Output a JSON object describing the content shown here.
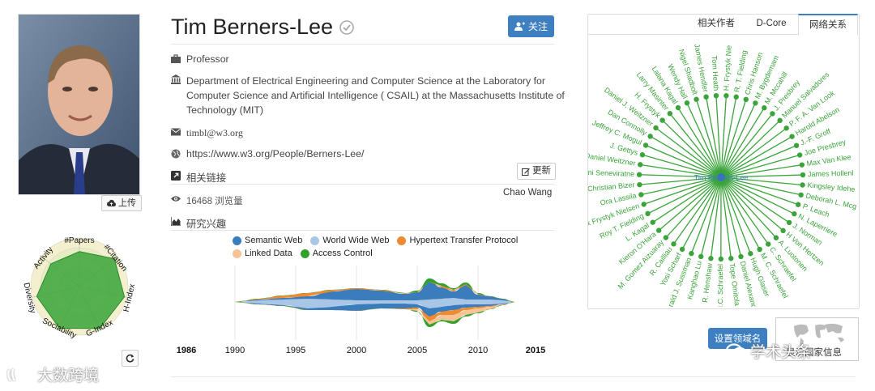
{
  "profile": {
    "name": "Tim Berners-Lee",
    "follow_label": "关注",
    "title": "Professor",
    "affiliation": "Department of Electrical Engineering and Computer Science at the Laboratory for Computer Science and Artificial Intelligence ( CSAIL) at the Massachusetts Institute of Technology (MIT)",
    "email": "timbl@w3.org",
    "homepage": "https://www.w3.org/People/Berners-Lee/",
    "related_links_label": "相关链接",
    "update_label": "更新",
    "editor": "Chao Wang",
    "views": "16468 浏览量",
    "interests_label": "研究兴趣",
    "upload_label": "上传"
  },
  "radar": {
    "axes": [
      "#Papers",
      "#Citation",
      "H-Index",
      "G-Index",
      "Sociability",
      "Diversity",
      "Activity"
    ],
    "values": [
      0.72,
      0.92,
      0.95,
      0.96,
      0.95,
      0.9,
      0.75
    ],
    "fill_color": "#3aa43a",
    "ring_colors": [
      "#f4f0cf",
      "#e6ecc4"
    ]
  },
  "interest_chart": {
    "legend": [
      {
        "name": "Semantic Web",
        "color": "#3b7cbd"
      },
      {
        "name": "World Wide Web",
        "color": "#a9c6e6"
      },
      {
        "name": "Hypertext Transfer Protocol",
        "color": "#ee8a2f"
      },
      {
        "name": "Linked Data",
        "color": "#f6c394"
      },
      {
        "name": "Access Control",
        "color": "#33a02c"
      }
    ],
    "start_year": "1986",
    "end_year": "2015",
    "ticks": [
      "1990",
      "1995",
      "2000",
      "2005",
      "2010"
    ]
  },
  "tabs": [
    {
      "label": "相关作者",
      "active": false
    },
    {
      "label": "D-Core",
      "active": false
    },
    {
      "label": "网络关系",
      "active": true
    }
  ],
  "network": {
    "center": "Tim Berners-Lee",
    "color": "#3aa43a",
    "nodes": [
      "Tom Heath",
      "H. Frystyk Nie",
      "R. T. Fielding",
      "Chris Hanson",
      "M. Bygdemam",
      "M. Mccahill",
      "J. Presbrey",
      "Manuel Salvadores",
      "P. F. A. Van Look",
      "Harold Abelson",
      "J.-F. Groff",
      "Joe Presbrey",
      "Max Van Klee",
      "James Hollenl",
      "Kingsley Idehe",
      "Deborah L. Mcg",
      "P. Leach",
      "N. Laperriere",
      "J. Norman",
      "H Von Hertzen",
      "A. Luotonen",
      "C. Schraefel",
      "M. C. Schraefel",
      "Hugh Glaser",
      "Daniel Alexander",
      "Tope Omitola",
      "M.C. Schraefel",
      "R. Henshaw",
      "Kanghao Lu",
      "Gerald J. Sussman",
      "Yosi Scharf",
      "R. Cailliau",
      "M. Gomez Aizuaray",
      "Kieron O'Hara",
      "L. Kagal",
      "Roy T. Fielding",
      "x Frystyk Nielsen",
      "Ora Lassila",
      "Christian Bizer",
      "ani Seneviratne",
      "Daniel Weitzner",
      "J. Gettys",
      "Jeffrey C. Mogul",
      "Dan Connolly",
      "Daniel J. Weitzner",
      "H. Frystyk",
      "Larry Masinter",
      "Lalana Kagal",
      "Wendy Hall",
      "Nigel Shadbolt",
      "James Hendler"
    ]
  },
  "actions": {
    "set_domain_label": "设置领域名",
    "world_map_label": "显示国家信息"
  },
  "watermarks": {
    "left": "大数跨境",
    "right": "学术头条"
  }
}
